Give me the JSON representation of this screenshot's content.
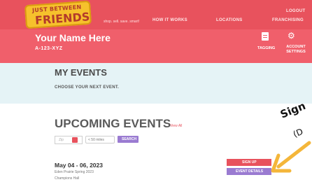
{
  "header": {
    "logo_line1": "JUST BETWEEN",
    "logo_line2": "FRIENDS",
    "tagline": "shop. sell. save. smart!",
    "nav": {
      "how_it_works": "HOW IT WORKS",
      "locations": "LOCATIONS",
      "franchising": "FRANCHISING",
      "logout": "LOGOUT"
    }
  },
  "profile": {
    "name": "Your Name Here",
    "id": "A-123-XYZ",
    "tagging_label": "TAGGING",
    "account_label_1": "ACCOUNT",
    "account_label_2": "SETTINGS"
  },
  "my_events": {
    "title": "MY EVENTS",
    "subtitle": "CHOOSE YOUR NEXT EVENT."
  },
  "upcoming": {
    "title": "UPCOMING EVENTS",
    "view_all": "View All",
    "zip_placeholder": "Zip",
    "miles_selected": "< 50 miles",
    "search_label": "SEARCH"
  },
  "event": {
    "date": "May 04 - 06, 2023",
    "name": "Eden Prairie Spring 2023",
    "venue": "Champions Hall",
    "signup_label": "SIGN UP",
    "details_label": "EVENT DETAILS"
  },
  "annotation": {
    "line1": "Sign",
    "line2": "(D"
  },
  "colors": {
    "brand_red": "#e8525d",
    "profile_red": "#f05f6b",
    "purple": "#9a7bd1",
    "light_teal": "#e5f3f6",
    "logo_yellow": "#f6c12c",
    "arrow_yellow": "#f4b63a"
  }
}
